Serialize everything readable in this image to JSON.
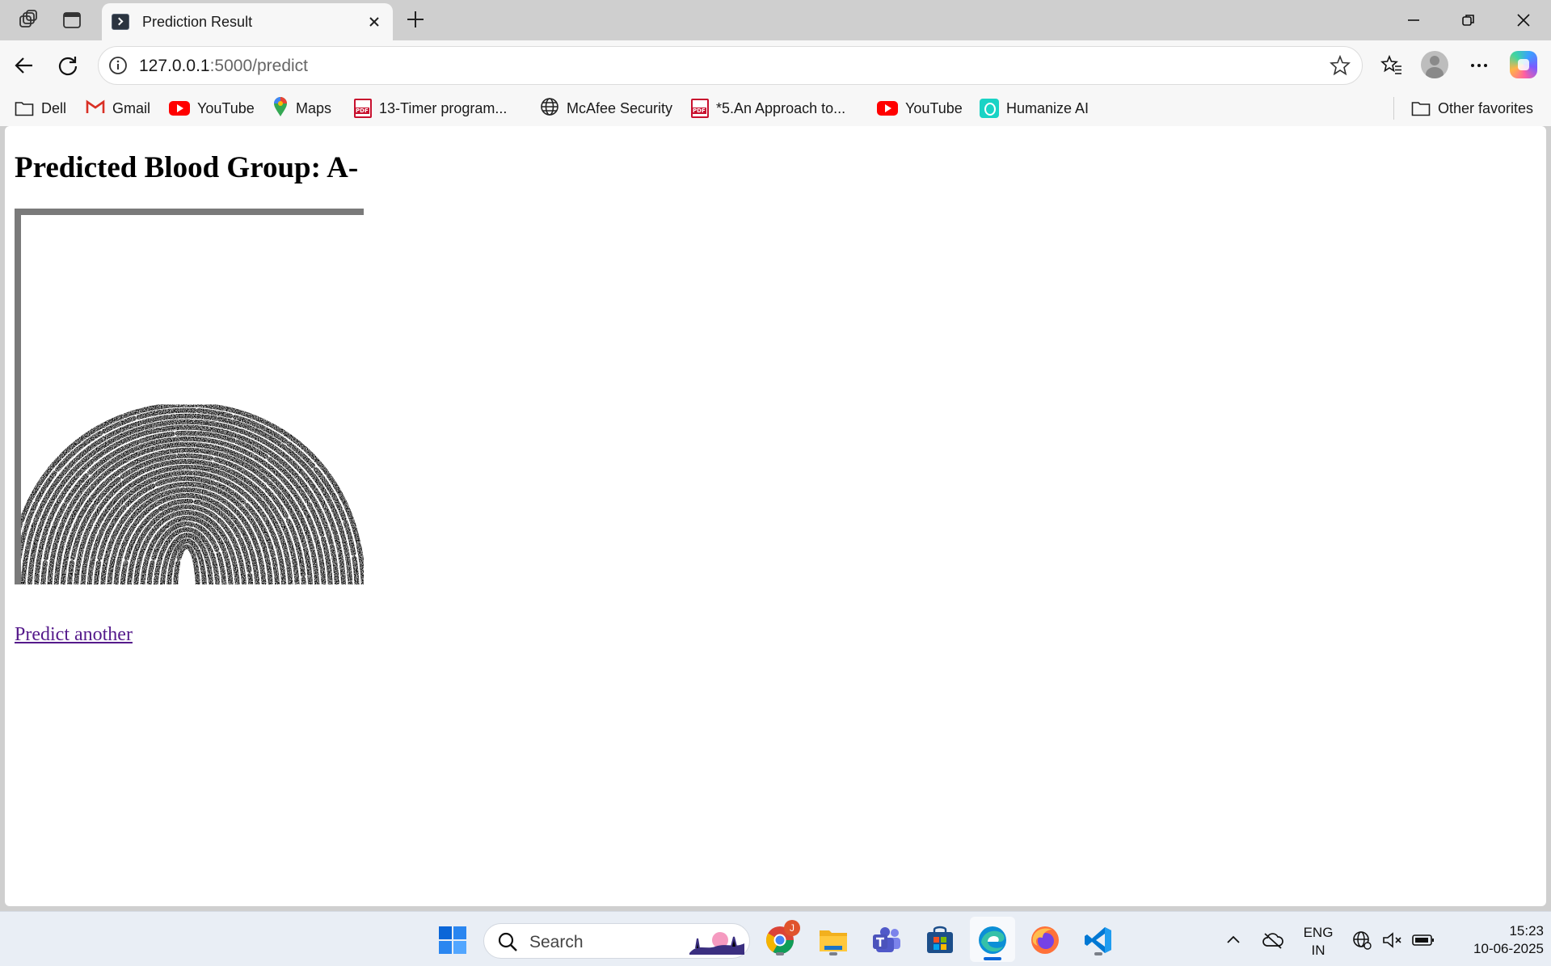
{
  "browser": {
    "tab_title": "Prediction Result",
    "url_host": "127.0.0.1",
    "url_rest": ":5000/predict"
  },
  "bookmarks": [
    {
      "label": "Dell",
      "icon": "folder-icon"
    },
    {
      "label": "Gmail",
      "icon": "gmail-icon"
    },
    {
      "label": "YouTube",
      "icon": "youtube-icon"
    },
    {
      "label": "Maps",
      "icon": "maps-icon"
    },
    {
      "label": "13-Timer program...",
      "icon": "pdf-icon"
    },
    {
      "label": "McAfee Security",
      "icon": "globe-icon"
    },
    {
      "label": "*5.An Approach to...",
      "icon": "pdf-icon"
    },
    {
      "label": "YouTube",
      "icon": "youtube-icon"
    },
    {
      "label": "Humanize AI",
      "icon": "humanize-icon"
    }
  ],
  "other_favorites": "Other favorites",
  "page": {
    "heading": "Predicted Blood Group: A-",
    "image_alt": "fingerprint image",
    "link": "Predict another"
  },
  "taskbar": {
    "search_placeholder": "Search",
    "chrome_badge": "J",
    "language_line1": "ENG",
    "language_line2": "IN",
    "time": "15:23",
    "date": "10-06-2025"
  },
  "colors": {
    "link_visited": "#551a8b",
    "tab_bg": "#f7f7f7",
    "chrome_frame": "#cfcfcf"
  }
}
